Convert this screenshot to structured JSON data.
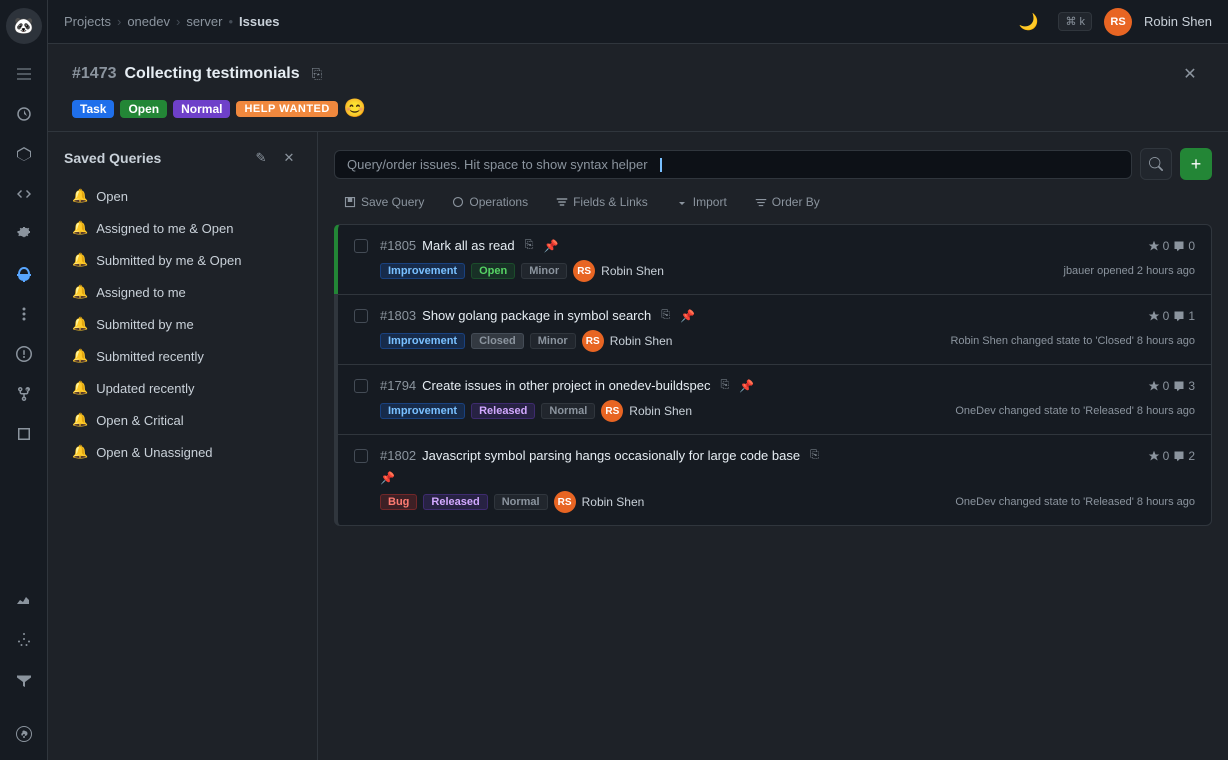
{
  "app": {
    "logo": "🐼",
    "breadcrumb": {
      "projects": "Projects",
      "sep1": "›",
      "onedev": "onedev",
      "sep2": "›",
      "server": "server",
      "sep3": "•",
      "issues": "Issues"
    },
    "shortcuts": "⌘ k",
    "user": "Robin Shen",
    "user_initials": "RS"
  },
  "issue_header": {
    "number": "#1473",
    "title": "Collecting testimonials",
    "badges": [
      {
        "label": "Task",
        "type": "task"
      },
      {
        "label": "Open",
        "type": "open"
      },
      {
        "label": "Normal",
        "type": "normal"
      },
      {
        "label": "HELP WANTED",
        "type": "help"
      }
    ],
    "emoji": "😊"
  },
  "saved_queries": {
    "title": "Saved Queries",
    "edit_label": "Edit",
    "close_label": "Close",
    "items": [
      {
        "label": "Open",
        "bell": true
      },
      {
        "label": "Assigned to me & Open",
        "bell": true
      },
      {
        "label": "Submitted by me & Open",
        "bell": true
      },
      {
        "label": "Assigned to me",
        "bell": true
      },
      {
        "label": "Submitted by me",
        "bell": true
      },
      {
        "label": "Submitted recently",
        "bell": true
      },
      {
        "label": "Updated recently",
        "bell": true
      },
      {
        "label": "Open & Critical",
        "bell": true
      },
      {
        "label": "Open & Unassigned",
        "bell": true
      }
    ]
  },
  "issues_toolbar": {
    "search_placeholder": "Query/order issues. Hit space to show syntax helper",
    "save_query": "Save Query",
    "operations": "Operations",
    "fields_links": "Fields & Links",
    "import": "Import",
    "order_by": "Order By"
  },
  "issues": [
    {
      "id": "#1805",
      "title": "Mark all as read",
      "tags": [
        {
          "label": "Improvement",
          "type": "improvement"
        },
        {
          "label": "Open",
          "type": "open"
        },
        {
          "label": "Minor",
          "type": "minor"
        }
      ],
      "avatar": "RS",
      "assignee": "Robin Shen",
      "votes": "0",
      "comments": "0",
      "activity": "jbauer opened 2 hours ago",
      "pinned": true
    },
    {
      "id": "#1803",
      "title": "Show golang package in symbol search",
      "tags": [
        {
          "label": "Improvement",
          "type": "improvement"
        },
        {
          "label": "Closed",
          "type": "closed"
        },
        {
          "label": "Minor",
          "type": "minor"
        }
      ],
      "avatar": "RS",
      "assignee": "Robin Shen",
      "votes": "0",
      "comments": "1",
      "activity": "Robin Shen changed state to 'Closed' 8 hours ago",
      "pinned": true
    },
    {
      "id": "#1794",
      "title": "Create issues in other project in onedev-buildspec",
      "tags": [
        {
          "label": "Improvement",
          "type": "improvement"
        },
        {
          "label": "Released",
          "type": "released"
        },
        {
          "label": "Normal",
          "type": "normal"
        }
      ],
      "avatar": "RS",
      "assignee": "Robin Shen",
      "votes": "0",
      "comments": "3",
      "activity": "OneDev changed state to 'Released' 8 hours ago",
      "pinned": true
    },
    {
      "id": "#1802",
      "title": "Javascript symbol parsing hangs occasionally for large code base",
      "tags": [
        {
          "label": "Bug",
          "type": "bug"
        },
        {
          "label": "Released",
          "type": "released"
        },
        {
          "label": "Normal",
          "type": "normal"
        }
      ],
      "avatar": "RS",
      "assignee": "Robin Shen",
      "votes": "0",
      "comments": "2",
      "activity": "OneDev changed state to 'Released' 8 hours ago",
      "pinned": false
    }
  ]
}
